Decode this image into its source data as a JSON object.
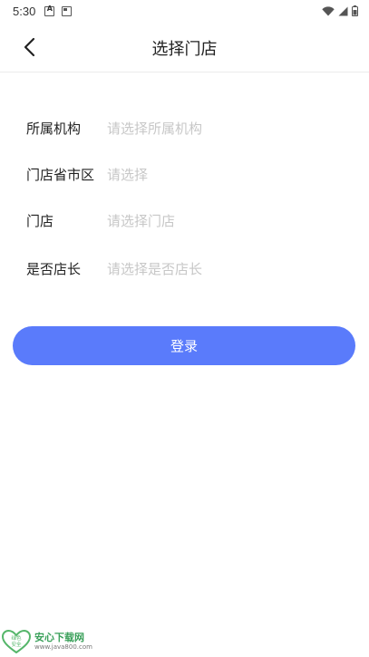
{
  "status_bar": {
    "time": "5:30",
    "icons": [
      "notification-a-icon",
      "notification-box-icon",
      "wifi-icon",
      "signal-icon",
      "battery-icon"
    ]
  },
  "header": {
    "title": "选择门店"
  },
  "form": {
    "rows": [
      {
        "label": "所属机构",
        "placeholder": "请选择所属机构"
      },
      {
        "label": "门店省市区",
        "placeholder": "请选择"
      },
      {
        "label": "门店",
        "placeholder": "请选择门店"
      },
      {
        "label": "是否店长",
        "placeholder": "请选择是否店长"
      }
    ]
  },
  "login_button": {
    "label": "登录",
    "color": "#5a7bfb"
  },
  "watermark": {
    "title": "安心下载网",
    "url": "www.java800.com",
    "badge_line1": "绿色",
    "badge_line2": "安全"
  }
}
